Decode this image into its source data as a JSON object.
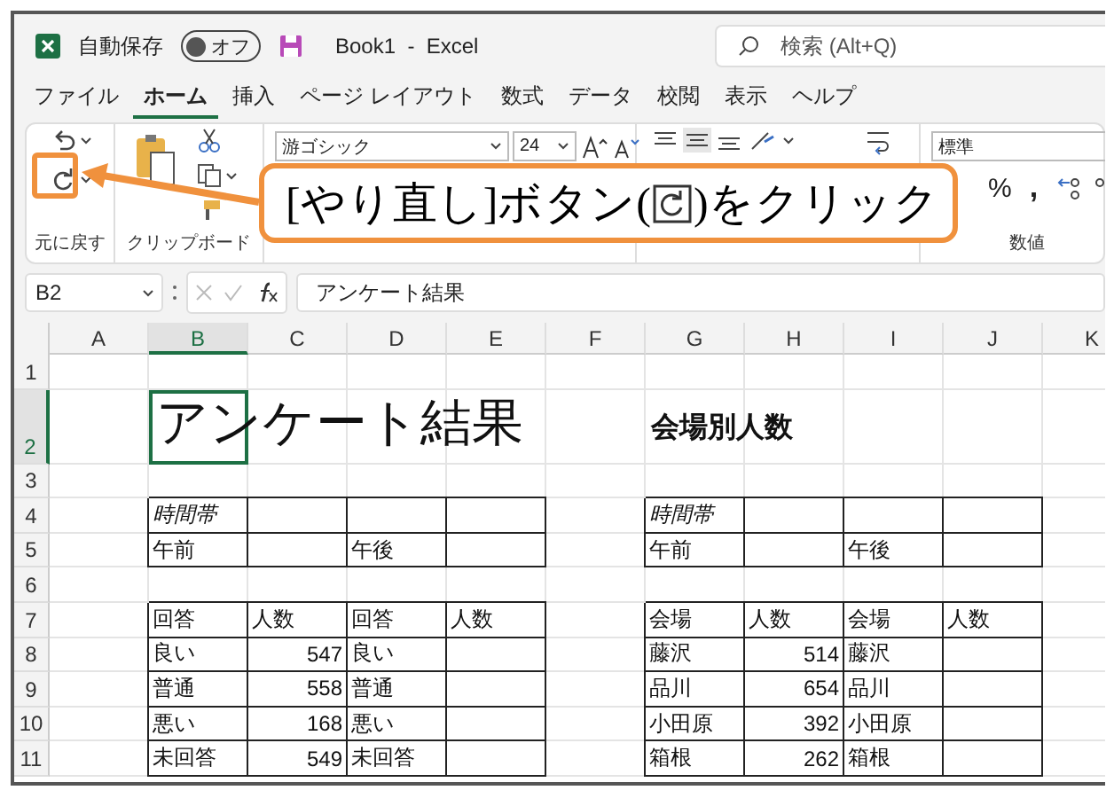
{
  "title_bar": {
    "autosave_label": "自動保存",
    "autosave_toggle": {
      "label": "オフ",
      "on": false
    },
    "document_title": "Book1  -  Excel",
    "search": {
      "placeholder": "検索 (Alt+Q)"
    }
  },
  "menu_tabs": [
    {
      "label": "ファイル",
      "selected": false
    },
    {
      "label": "ホーム",
      "selected": true
    },
    {
      "label": "挿入",
      "selected": false
    },
    {
      "label": "ページ レイアウト",
      "selected": false
    },
    {
      "label": "数式",
      "selected": false
    },
    {
      "label": "データ",
      "selected": false
    },
    {
      "label": "校閲",
      "selected": false
    },
    {
      "label": "表示",
      "selected": false
    },
    {
      "label": "ヘルプ",
      "selected": false
    }
  ],
  "ribbon": {
    "groups": [
      {
        "kind": "undo",
        "label": "元に戻す"
      },
      {
        "kind": "clipboard",
        "label": "クリップボード"
      },
      {
        "kind": "font",
        "font_name": "游ゴシック",
        "font_size": "24"
      },
      {
        "kind": "alignment"
      },
      {
        "kind": "number",
        "label": "数値",
        "number_format": "標準",
        "percent": "%",
        "comma": ","
      }
    ]
  },
  "callout": {
    "before": "[やり直し]ボタン(",
    "after": ")をクリック"
  },
  "formula_bar": {
    "name_box": "B2",
    "content": "アンケート結果"
  },
  "sheet": {
    "columns": [
      {
        "label": "A",
        "selected": false
      },
      {
        "label": "B",
        "selected": true
      },
      {
        "label": "C",
        "selected": false
      },
      {
        "label": "D",
        "selected": false
      },
      {
        "label": "E",
        "selected": false
      },
      {
        "label": "F",
        "selected": false
      },
      {
        "label": "G",
        "selected": false
      },
      {
        "label": "H",
        "selected": false
      },
      {
        "label": "I",
        "selected": false
      },
      {
        "label": "J",
        "selected": false
      },
      {
        "label": "K",
        "selected": false
      }
    ],
    "rows": [
      {
        "number": "1",
        "selected": false
      },
      {
        "number": "2",
        "selected": true,
        "cells": [
          null,
          {
            "kind": "title",
            "text": "アンケート結果",
            "selected": true
          },
          null,
          null,
          null,
          null,
          {
            "kind": "heading",
            "text": "会場別人数",
            "selected": false
          }
        ]
      },
      {
        "number": "3",
        "selected": false
      },
      {
        "number": "4",
        "selected": false,
        "cells": [
          null,
          {
            "kind": "italic",
            "text": "時間帯",
            "bordered": true
          },
          {
            "bordered": true
          },
          {
            "bordered": true
          },
          {
            "bordered": true
          },
          null,
          {
            "kind": "italic",
            "text": "時間帯",
            "bordered": true
          },
          {
            "bordered": true
          },
          {
            "bordered": true
          },
          {
            "bordered": true
          }
        ]
      },
      {
        "number": "5",
        "selected": false,
        "cells": [
          null,
          {
            "text": "午前",
            "bordered": true
          },
          {
            "bordered": true
          },
          {
            "text": "午後",
            "bordered": true
          },
          {
            "bordered": true
          },
          null,
          {
            "text": "午前",
            "bordered": true
          },
          {
            "bordered": true
          },
          {
            "text": "午後",
            "bordered": true
          },
          {
            "bordered": true
          }
        ]
      },
      {
        "number": "6",
        "selected": false
      },
      {
        "number": "7",
        "selected": false,
        "cells": [
          null,
          {
            "text": "回答",
            "bordered": true
          },
          {
            "text": "人数",
            "bordered": true
          },
          {
            "text": "回答",
            "bordered": true
          },
          {
            "text": "人数",
            "bordered": true
          },
          null,
          {
            "text": "会場",
            "bordered": true
          },
          {
            "text": "人数",
            "bordered": true
          },
          {
            "text": "会場",
            "bordered": true
          },
          {
            "text": "人数",
            "bordered": true
          }
        ]
      },
      {
        "number": "8",
        "selected": false,
        "cells": [
          null,
          {
            "text": "良い",
            "bordered": true
          },
          {
            "kind": "number",
            "text": "547",
            "bordered": true
          },
          {
            "text": "良い",
            "bordered": true
          },
          {
            "bordered": true
          },
          null,
          {
            "text": "藤沢",
            "bordered": true
          },
          {
            "kind": "number",
            "text": "514",
            "bordered": true
          },
          {
            "text": "藤沢",
            "bordered": true
          },
          {
            "bordered": true
          }
        ]
      },
      {
        "number": "9",
        "selected": false,
        "cells": [
          null,
          {
            "text": "普通",
            "bordered": true
          },
          {
            "kind": "number",
            "text": "558",
            "bordered": true
          },
          {
            "text": "普通",
            "bordered": true
          },
          {
            "bordered": true
          },
          null,
          {
            "text": "品川",
            "bordered": true
          },
          {
            "kind": "number",
            "text": "654",
            "bordered": true
          },
          {
            "text": "品川",
            "bordered": true
          },
          {
            "bordered": true
          }
        ]
      },
      {
        "number": "10",
        "selected": false,
        "cells": [
          null,
          {
            "text": "悪い",
            "bordered": true
          },
          {
            "kind": "number",
            "text": "168",
            "bordered": true
          },
          {
            "text": "悪い",
            "bordered": true
          },
          {
            "bordered": true
          },
          null,
          {
            "text": "小田原",
            "bordered": true
          },
          {
            "kind": "number",
            "text": "392",
            "bordered": true
          },
          {
            "text": "小田原",
            "bordered": true
          },
          {
            "bordered": true
          }
        ]
      },
      {
        "number": "11",
        "selected": false,
        "cells": [
          null,
          {
            "text": "未回答",
            "bordered": true
          },
          {
            "kind": "number",
            "text": "549",
            "bordered": true
          },
          {
            "text": "未回答",
            "bordered": true
          },
          {
            "bordered": true
          },
          null,
          {
            "text": "箱根",
            "bordered": true
          },
          {
            "kind": "number",
            "text": "262",
            "bordered": true
          },
          {
            "text": "箱根",
            "bordered": true
          },
          {
            "bordered": true
          }
        ]
      }
    ]
  }
}
